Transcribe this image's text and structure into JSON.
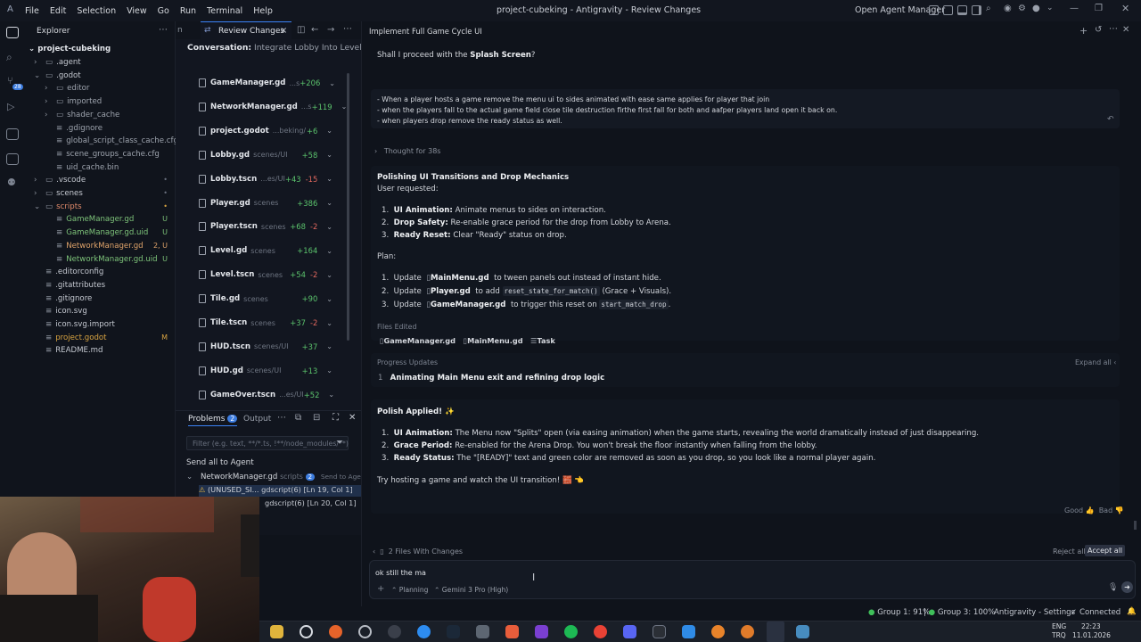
{
  "titlebar": {
    "menus": [
      "File",
      "Edit",
      "Selection",
      "View",
      "Go",
      "Run",
      "Terminal",
      "Help"
    ],
    "title": "project-cubeking - Antigravity - Review Changes",
    "open_agent_manager": "Open Agent Manager"
  },
  "explorer": {
    "header": "Explorer",
    "root": "project-cubeking",
    "items": [
      {
        "label": ".agent",
        "depth": 1,
        "type": "folder",
        "color": "#c5c9d1",
        "badge": "",
        "badge_color": ""
      },
      {
        "label": ".godot",
        "depth": 1,
        "type": "folder-open",
        "color": "#c5c9d1",
        "badge": "",
        "badge_color": ""
      },
      {
        "label": "editor",
        "depth": 2,
        "type": "folder",
        "color": "#9ea4ae",
        "badge": "",
        "badge_color": ""
      },
      {
        "label": "imported",
        "depth": 2,
        "type": "folder",
        "color": "#9ea4ae",
        "badge": "",
        "badge_color": ""
      },
      {
        "label": "shader_cache",
        "depth": 2,
        "type": "folder",
        "color": "#9ea4ae",
        "badge": "",
        "badge_color": ""
      },
      {
        "label": ".gdignore",
        "depth": 2,
        "type": "file",
        "color": "#9ea4ae",
        "badge": "",
        "badge_color": ""
      },
      {
        "label": "global_script_class_cache.cfg",
        "depth": 2,
        "type": "file",
        "color": "#9ea4ae",
        "badge": "",
        "badge_color": ""
      },
      {
        "label": "scene_groups_cache.cfg",
        "depth": 2,
        "type": "file",
        "color": "#9ea4ae",
        "badge": "",
        "badge_color": ""
      },
      {
        "label": "uid_cache.bin",
        "depth": 2,
        "type": "file",
        "color": "#9ea4ae",
        "badge": "",
        "badge_color": ""
      },
      {
        "label": ".vscode",
        "depth": 1,
        "type": "folder",
        "color": "#c5c9d1",
        "badge": "•",
        "badge_color": "#6b7280"
      },
      {
        "label": "scenes",
        "depth": 1,
        "type": "folder",
        "color": "#c5c9d1",
        "badge": "•",
        "badge_color": "#6b7280"
      },
      {
        "label": "scripts",
        "depth": 1,
        "type": "folder-open",
        "color": "#e08a6b",
        "badge": "•",
        "badge_color": "#d9a441"
      },
      {
        "label": "GameManager.gd",
        "depth": 2,
        "type": "file",
        "color": "#7ec47a",
        "badge": "U",
        "badge_color": "#7ec47a"
      },
      {
        "label": "GameManager.gd.uid",
        "depth": 2,
        "type": "file",
        "color": "#7ec47a",
        "badge": "U",
        "badge_color": "#7ec47a"
      },
      {
        "label": "NetworkManager.gd",
        "depth": 2,
        "type": "file",
        "color": "#e0a46a",
        "badge": "2, U",
        "badge_color": "#e0a46a"
      },
      {
        "label": "NetworkManager.gd.uid",
        "depth": 2,
        "type": "file",
        "color": "#7ec47a",
        "badge": "U",
        "badge_color": "#7ec47a"
      },
      {
        "label": ".editorconfig",
        "depth": 1,
        "type": "file",
        "color": "#c5c9d1",
        "badge": "",
        "badge_color": ""
      },
      {
        "label": ".gitattributes",
        "depth": 1,
        "type": "file",
        "color": "#c5c9d1",
        "badge": "",
        "badge_color": ""
      },
      {
        "label": ".gitignore",
        "depth": 1,
        "type": "file",
        "color": "#c5c9d1",
        "badge": "",
        "badge_color": ""
      },
      {
        "label": "icon.svg",
        "depth": 1,
        "type": "file",
        "color": "#c5c9d1",
        "badge": "",
        "badge_color": ""
      },
      {
        "label": "icon.svg.import",
        "depth": 1,
        "type": "file",
        "color": "#c5c9d1",
        "badge": "",
        "badge_color": ""
      },
      {
        "label": "project.godot",
        "depth": 1,
        "type": "file",
        "color": "#d9a441",
        "badge": "M",
        "badge_color": "#d9a441"
      },
      {
        "label": "README.md",
        "depth": 1,
        "type": "file",
        "color": "#c5c9d1",
        "badge": "",
        "badge_color": ""
      }
    ]
  },
  "editor_tabs": {
    "prev_tab": "n",
    "active_tab": "Review Changes"
  },
  "review": {
    "conversation_label": "Conversation:",
    "conversation_title": "Integrate Lobby Into Level",
    "files": [
      {
        "name": "GameManager.gd",
        "dir": "...s",
        "add": "+206",
        "del": ""
      },
      {
        "name": "NetworkManager.gd",
        "dir": "...s",
        "add": "+119",
        "del": ""
      },
      {
        "name": "project.godot",
        "dir": "...beking/",
        "add": "+6",
        "del": ""
      },
      {
        "name": "Lobby.gd",
        "dir": "scenes/UI",
        "add": "+58",
        "del": ""
      },
      {
        "name": "Lobby.tscn",
        "dir": "...es/UI",
        "add": "+43",
        "del": "-15"
      },
      {
        "name": "Player.gd",
        "dir": "scenes",
        "add": "+386",
        "del": ""
      },
      {
        "name": "Player.tscn",
        "dir": "scenes",
        "add": "+68",
        "del": "-2"
      },
      {
        "name": "Level.gd",
        "dir": "scenes",
        "add": "+164",
        "del": ""
      },
      {
        "name": "Level.tscn",
        "dir": "scenes",
        "add": "+54",
        "del": "-2"
      },
      {
        "name": "Tile.gd",
        "dir": "scenes",
        "add": "+90",
        "del": ""
      },
      {
        "name": "Tile.tscn",
        "dir": "scenes",
        "add": "+37",
        "del": "-2"
      },
      {
        "name": "HUD.tscn",
        "dir": "scenes/UI",
        "add": "+37",
        "del": ""
      },
      {
        "name": "HUD.gd",
        "dir": "scenes/UI",
        "add": "+13",
        "del": ""
      },
      {
        "name": "GameOver.tscn",
        "dir": "...es/UI",
        "add": "+52",
        "del": ""
      }
    ]
  },
  "problems": {
    "tab_problems": "Problems",
    "count": "2",
    "tab_output": "Output",
    "filter_placeholder": "Filter (e.g. text, **/*.ts, !**/node_modules/**)",
    "send_all": "Send all to Agent",
    "file": "NetworkManager.gd",
    "file_dir": "scripts",
    "file_count": "2",
    "send_to": "Send to Agen",
    "issue1": "(UNUSED_SI...",
    "issue1_src": "gdscript(6) [Ln 19, Col 1]",
    "issue2_src": "gdscript(6) [Ln 20, Col 1]"
  },
  "chat": {
    "panel_title": "Implement Full Game Cycle UI",
    "q_prefix": "Shall I proceed with the",
    "q_bold": "Splash Screen",
    "q_suffix": "?",
    "user_msg": [
      "- When a player hosts a game remove the menu ui to sides animated with ease same applies for player that join",
      "- when the players fall to the actual game field close tile destruction firthe first fall for both and aafper players land open it back on.",
      "- when players drop remove the ready status as well."
    ],
    "thought": "Thought for 38s",
    "plan_title": "Polishing UI Transitions and Drop Mechanics",
    "plan_user": "User requested:",
    "req": [
      {
        "n": "1.",
        "b": "UI Animation:",
        "t": "Animate menus to sides on interaction."
      },
      {
        "n": "2.",
        "b": "Drop Safety:",
        "t": "Re-enable grace period for the drop from Lobby to Arena."
      },
      {
        "n": "3.",
        "b": "Ready Reset:",
        "t": "Clear \"Ready\" status on drop."
      }
    ],
    "plan_label": "Plan:",
    "plan": [
      {
        "n": "1.",
        "pre": "Update",
        "file": "MainMenu.gd",
        "post": "to tween panels out instead of instant hide."
      },
      {
        "n": "2.",
        "pre": "Update",
        "file": "Player.gd",
        "post": "to add",
        "code": "reset_state_for_match()",
        "post2": "(Grace + Visuals)."
      },
      {
        "n": "3.",
        "pre": "Update",
        "file": "GameManager.gd",
        "post": "to trigger this reset on",
        "code": "start_match_drop",
        "post2": "."
      }
    ],
    "files_edited_label": "Files Edited",
    "files_edited": [
      "GameManager.gd",
      "MainMenu.gd",
      "Task"
    ],
    "progress_label": "Progress Updates",
    "expand_all": "Expand all",
    "progress_item_n": "1",
    "progress_item": "Animating Main Menu exit and refining drop logic",
    "applied_title": "Polish Applied! ✨",
    "applied": [
      {
        "n": "1.",
        "b": "UI Animation:",
        "t": "The Menu now \"Splits\" open (via easing animation) when the game starts, revealing the world dramatically instead of just disappearing."
      },
      {
        "n": "2.",
        "b": "Grace Period:",
        "t": "Re-enabled for the Arena Drop. You won't break the floor instantly when falling from the lobby."
      },
      {
        "n": "3.",
        "b": "Ready Status:",
        "t": "The \"[READY]\" text and green color are removed as soon as you drop, so you look like a normal player again."
      }
    ],
    "closing": "Try hosting a game and watch the UI transition! 🧱 👈",
    "good": "Good",
    "bad": "Bad",
    "files_changes": "2 Files With Changes",
    "reject_all": "Reject all",
    "accept_all": "Accept all",
    "input_value": "ok still the ma",
    "mode": "Planning",
    "model": "Gemini 3 Pro (High)"
  },
  "statusbar": {
    "group1": "Group 1: 91%",
    "group3": "Group 3: 100%",
    "settings": "Antigravity - Settings",
    "connected": "Connected"
  },
  "taskbar": {
    "lang1": "ENG",
    "lang2": "TRQ",
    "time": "22:23",
    "date": "11.01.2026"
  }
}
